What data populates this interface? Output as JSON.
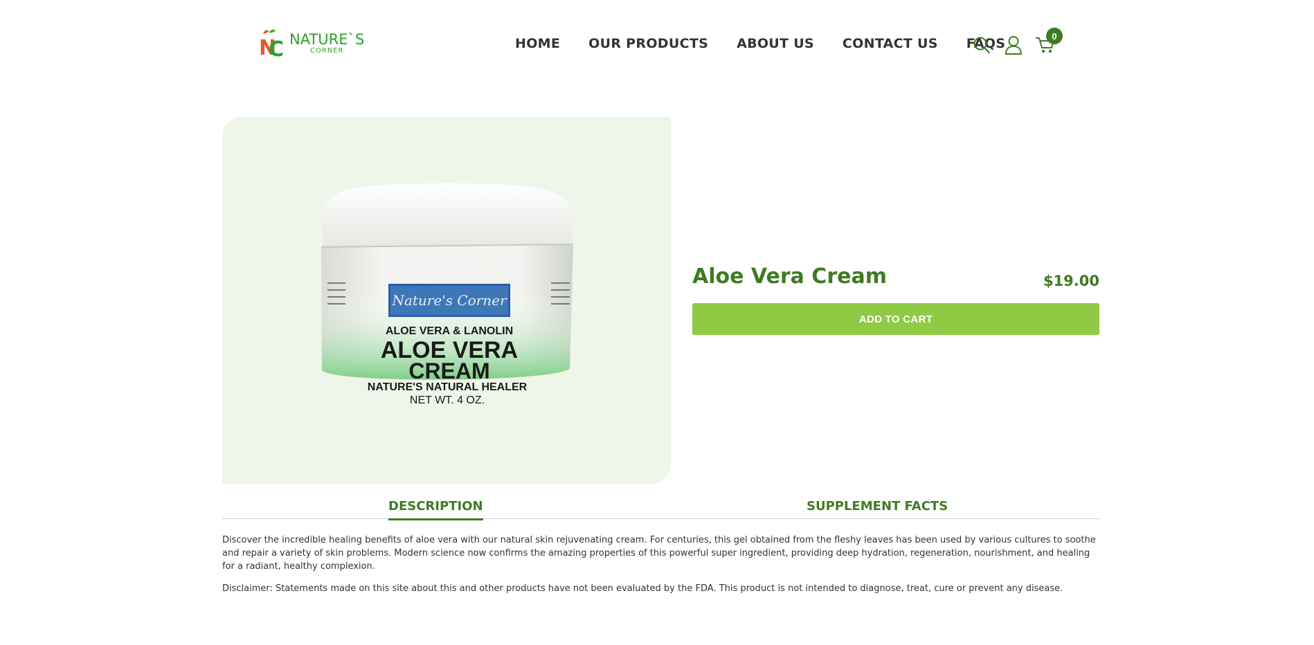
{
  "brand": {
    "name": "NATURE`S",
    "sub": "CORNER"
  },
  "nav": {
    "items": [
      {
        "label": "HOME"
      },
      {
        "label": "OUR PRODUCTS"
      },
      {
        "label": "ABOUT US"
      },
      {
        "label": "CONTACT US"
      },
      {
        "label": "FAQS"
      }
    ]
  },
  "header_icons": {
    "search": "search-icon",
    "account": "user-icon",
    "cart": "cart-icon",
    "cart_count": "0"
  },
  "product": {
    "title": "Aloe Vera Cream",
    "price": "$19.00",
    "add_to_cart": "ADD TO CART",
    "image_label": {
      "brand": "Nature's Corner",
      "line1": "ALOE VERA & LANOLIN",
      "line2": "ALOE VERA",
      "line3": "CREAM",
      "line4": "NATURE'S NATURAL HEALER",
      "line5": "NET WT. 4 OZ."
    }
  },
  "tabs": [
    {
      "label": "DESCRIPTION",
      "active": true
    },
    {
      "label": "SUPPLEMENT FACTS",
      "active": false
    }
  ],
  "description": {
    "paragraph": "Discover the incredible healing benefits of aloe vera with our natural skin rejuvenating cream. For centuries, this gel obtained from the fleshy leaves has been used by various cultures to soothe and repair a variety of skin problems. Modern science now confirms the amazing properties of this powerful super ingredient, providing deep hydration, regeneration, nourishment, and healing for a radiant, healthy complexion.",
    "disclaimer": "Disclaimer: Statements made on this site about this and other products have not been evaluated by the FDA. This product is not intended to diagnose, treat, cure or prevent any disease."
  },
  "colors": {
    "accent": "#3f7b22",
    "button": "#8fca45",
    "image_bg": "#eef5e9"
  }
}
